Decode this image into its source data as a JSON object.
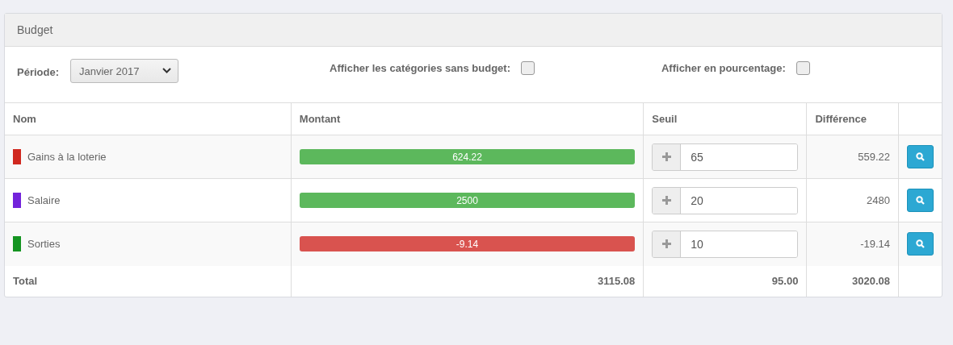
{
  "panel": {
    "title": "Budget"
  },
  "filters": {
    "period_label": "Période:",
    "period_value": "Janvier 2017",
    "options": [
      {
        "label": "Afficher les catégories sans budget:",
        "checked": false
      },
      {
        "label": "Afficher en pourcentage:",
        "checked": false
      }
    ]
  },
  "table": {
    "columns": [
      "Nom",
      "Montant",
      "Seuil",
      "Différence"
    ],
    "rows": [
      {
        "name": "Gains à la loterie",
        "color": "#d0281f",
        "amount": "624.22",
        "level": 1,
        "kind": "positive",
        "threshold": "65",
        "difference": "559.22"
      },
      {
        "name": "Salaire",
        "color": "#7323db",
        "amount": "2500",
        "level": 1,
        "kind": "positive",
        "threshold": "20",
        "difference": "2480"
      },
      {
        "name": "Sorties",
        "color": "#149421",
        "amount": "-9.14",
        "level": 1,
        "kind": "negative",
        "threshold": "10",
        "difference": "-19.14"
      }
    ],
    "total": {
      "label": "Total",
      "amount": "3115.08",
      "threshold": "95.00",
      "difference": "3020.08"
    }
  }
}
